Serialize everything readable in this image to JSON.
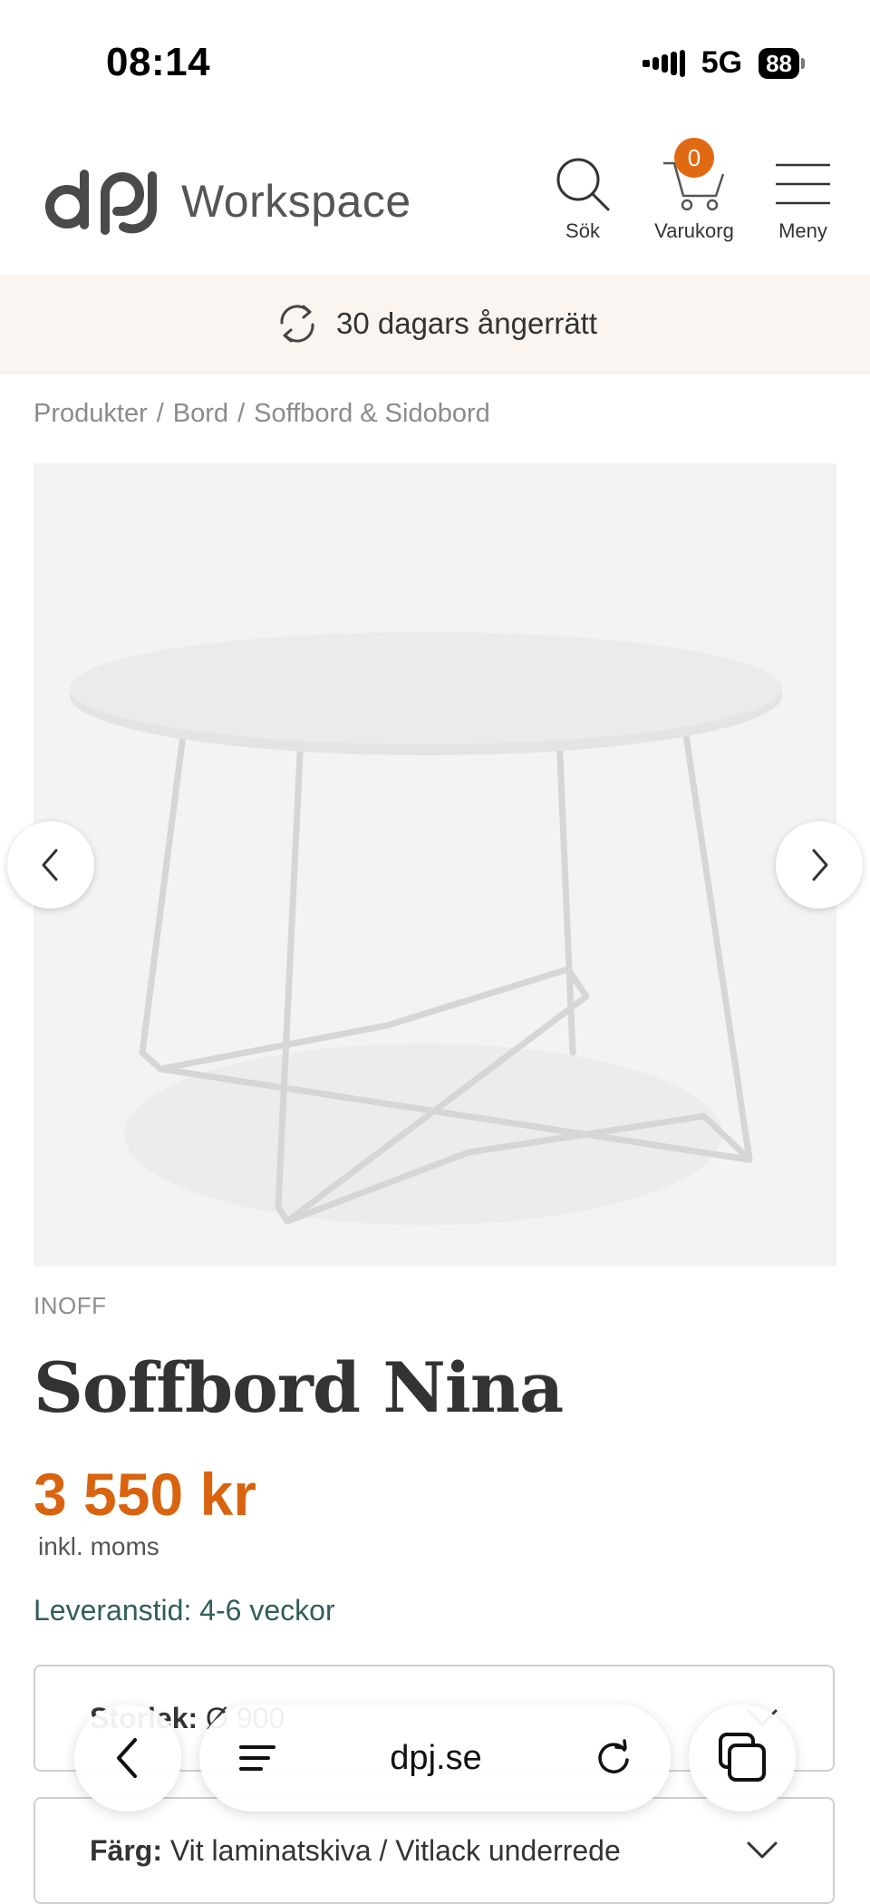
{
  "status_bar": {
    "time": "08:14",
    "network": "5G",
    "battery": "88"
  },
  "header": {
    "logo_text": "Workspace",
    "search_label": "Sök",
    "cart_label": "Varukorg",
    "cart_count": "0",
    "menu_label": "Meny"
  },
  "banner": {
    "text": "30 dagars ångerrätt"
  },
  "breadcrumb": {
    "items": [
      "Produkter",
      "Bord",
      "Soffbord & Sidobord"
    ],
    "separator": "/"
  },
  "product": {
    "brand": "INOFF",
    "title": "Soffbord Nina",
    "price": "3 550 kr",
    "vat_note": "inkl. moms",
    "delivery": "Leveranstid: 4-6 veckor"
  },
  "options": {
    "size": {
      "label": "Storlek:",
      "value": "Ø 900"
    },
    "color": {
      "label": "Färg:",
      "value": "Vit laminatskiva / Vitlack underrede"
    }
  },
  "browser": {
    "url": "dpj.se"
  },
  "colors": {
    "accent": "#d9630f",
    "delivery": "#2f5e5a",
    "banner_bg": "#faf5f1"
  }
}
